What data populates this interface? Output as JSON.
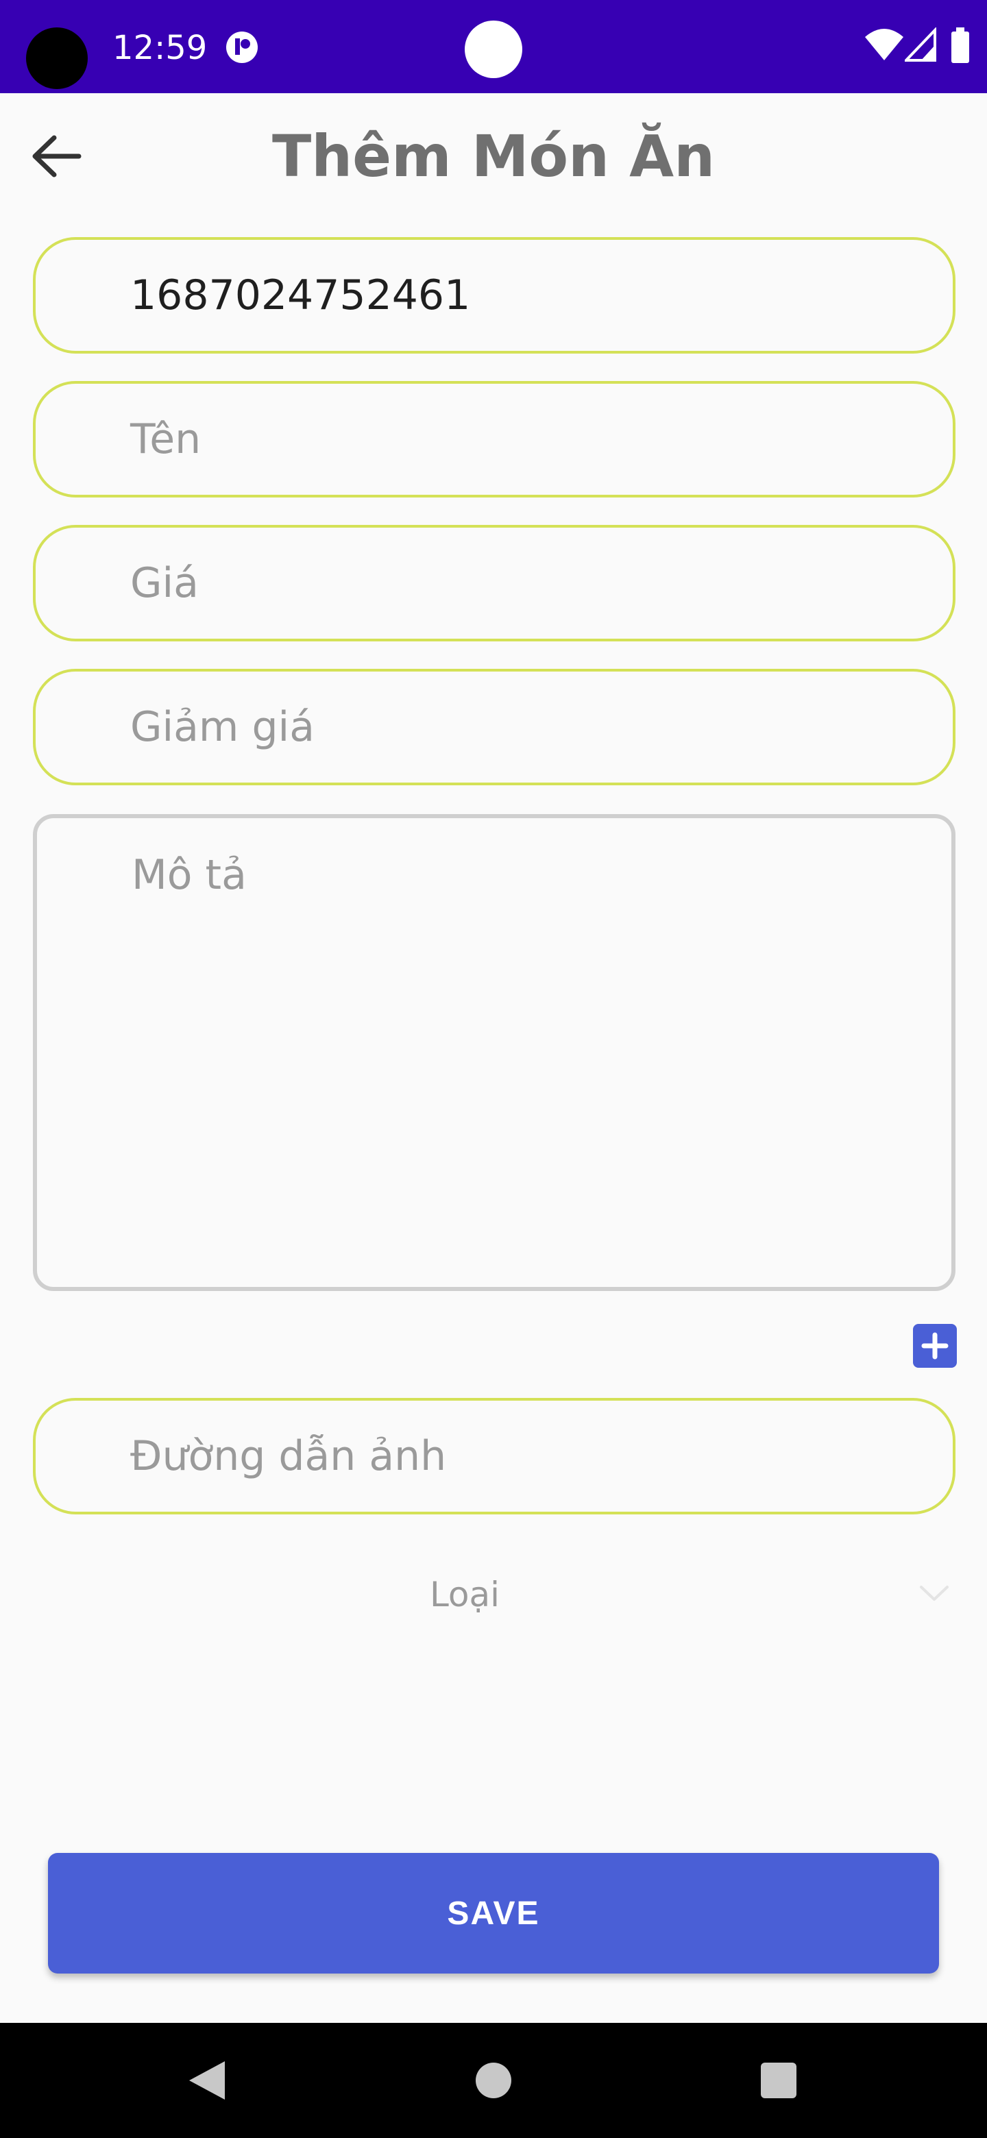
{
  "status_bar": {
    "time": "12:59",
    "icons": [
      "camera-cutout-icon",
      "app-notification-icon",
      "wifi-icon",
      "signal-icon",
      "battery-icon"
    ]
  },
  "toolbar": {
    "title": "Thêm Món Ăn",
    "back_icon": "arrow-left-icon"
  },
  "form": {
    "id_value": "1687024752461",
    "name_placeholder": "Tên",
    "price_placeholder": "Giá",
    "discount_placeholder": "Giảm giá",
    "description_placeholder": "Mô tả",
    "image_path_placeholder": "Đường dẫn ảnh",
    "category_label": "Loại",
    "add_icon": "plus-icon",
    "dropdown_icon": "chevron-down-icon"
  },
  "actions": {
    "save_label": "SAVE"
  },
  "nav_bar": {
    "icons": [
      "back-triangle-icon",
      "home-circle-icon",
      "recents-square-icon"
    ]
  },
  "colors": {
    "status_bar": "#3700b3",
    "accent": "#4a5fd6",
    "field_border": "#d4e157",
    "description_border": "#cfcfcf",
    "title_text": "#707070",
    "placeholder": "#9a9a9a",
    "background": "#fafafa"
  }
}
